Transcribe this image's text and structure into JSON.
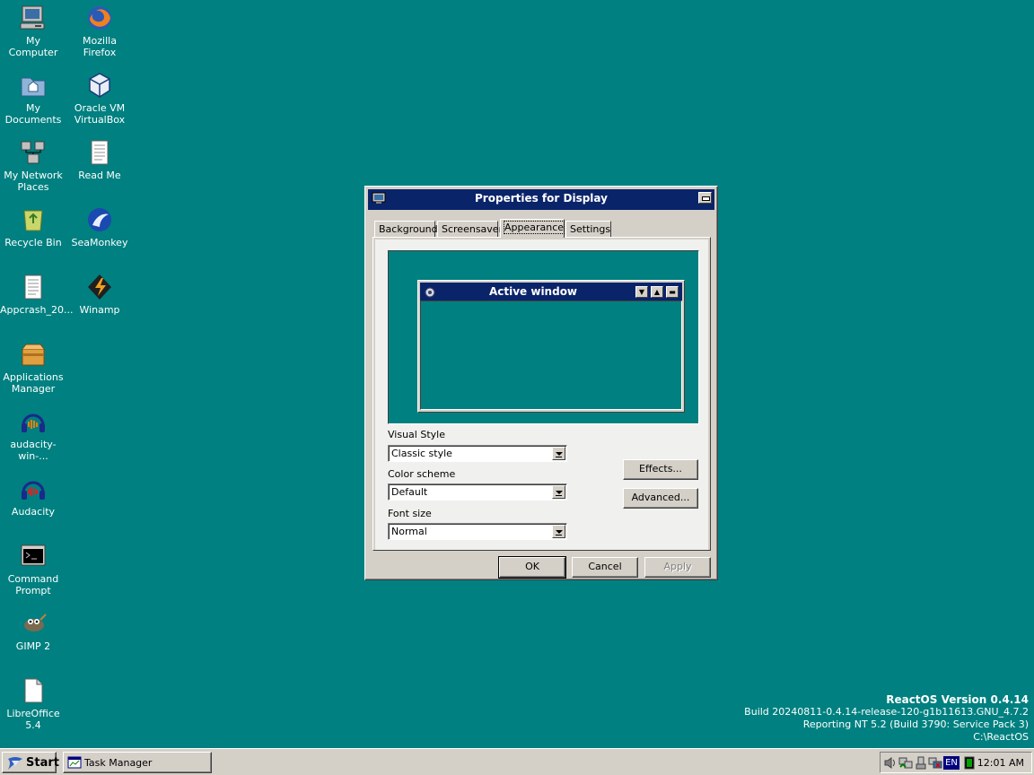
{
  "desktop": {
    "icons": [
      {
        "label": "My\nComputer",
        "icon": "computer-icon"
      },
      {
        "label": "Mozilla\nFirefox",
        "icon": "firefox-icon"
      },
      {
        "label": "My\nDocuments",
        "icon": "documents-folder-icon"
      },
      {
        "label": "Oracle VM\nVirtualBox",
        "icon": "virtualbox-icon"
      },
      {
        "label": "My Network\nPlaces",
        "icon": "network-icon"
      },
      {
        "label": "Read Me",
        "icon": "text-file-icon"
      },
      {
        "label": "Recycle Bin",
        "icon": "recycle-bin-icon"
      },
      {
        "label": "SeaMonkey",
        "icon": "seamonkey-icon"
      },
      {
        "label": "Appcrash_20...",
        "icon": "text-file-icon"
      },
      {
        "label": "Winamp",
        "icon": "winamp-icon"
      },
      {
        "label": "Applications\nManager",
        "icon": "package-icon"
      },
      {
        "label": "audacity-win-...",
        "icon": "audacity-icon"
      },
      {
        "label": "Audacity",
        "icon": "audacity-icon"
      },
      {
        "label": "Command\nPrompt",
        "icon": "terminal-icon"
      },
      {
        "label": "GIMP 2",
        "icon": "gimp-icon"
      },
      {
        "label": "LibreOffice\n5.4",
        "icon": "libreoffice-icon"
      }
    ]
  },
  "dialog": {
    "title": "Properties for Display",
    "tabs": [
      "Background",
      "Screensaver",
      "Appearance",
      "Settings"
    ],
    "active_tab": "Appearance",
    "preview": {
      "title": "Active window"
    },
    "visual_style": {
      "label": "Visual Style",
      "value": "Classic style"
    },
    "color_scheme": {
      "label": "Color scheme",
      "value": "Default"
    },
    "font_size": {
      "label": "Font size",
      "value": "Normal"
    },
    "effects_button": "Effects...",
    "advanced_button": "Advanced...",
    "ok_button": "OK",
    "cancel_button": "Cancel",
    "apply_button": "Apply"
  },
  "version": {
    "title": "ReactOS Version 0.4.14",
    "build": "Build 20240811-0.4.14-release-120-g1b11613.GNU_4.7.2",
    "reporting": "Reporting NT 5.2 (Build 3790: Service Pack 3)",
    "path": "C:\\ReactOS"
  },
  "taskbar": {
    "start_label": "Start",
    "tasks": [
      "Task Manager"
    ],
    "language": "EN",
    "clock": "12:01 AM"
  },
  "colors": {
    "desktop": "#008080",
    "title_active": "#0a246a",
    "face": "#d4d0c8"
  }
}
